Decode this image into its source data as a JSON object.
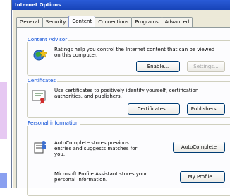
{
  "window": {
    "title": "Internet Options"
  },
  "tabs": [
    {
      "label": "General"
    },
    {
      "label": "Security"
    },
    {
      "label": "Content"
    },
    {
      "label": "Connections"
    },
    {
      "label": "Programs"
    },
    {
      "label": "Advanced"
    }
  ],
  "content_advisor": {
    "label": "Content Advisor",
    "description": "Ratings help you control the Internet content that can be viewed on this computer.",
    "enable_button": "Enable...",
    "settings_button": "Settings..."
  },
  "certificates": {
    "label": "Certificates",
    "description": "Use certificates to positively identify yourself, certification authorities, and publishers.",
    "certificates_button": "Certificates...",
    "publishers_button": "Publishers..."
  },
  "personal_information": {
    "label": "Personal information",
    "autocomplete_description": "AutoComplete stores previous entries and suggests matches for you.",
    "autocomplete_button": "AutoComplete",
    "profile_description": "Microsoft Profile Assistant stores your personal information.",
    "profile_button": "My Profile..."
  },
  "colors": {
    "titlebar": "#1f4fc9",
    "dialog_bg": "#ece9d8",
    "group_label": "#0046d5"
  }
}
